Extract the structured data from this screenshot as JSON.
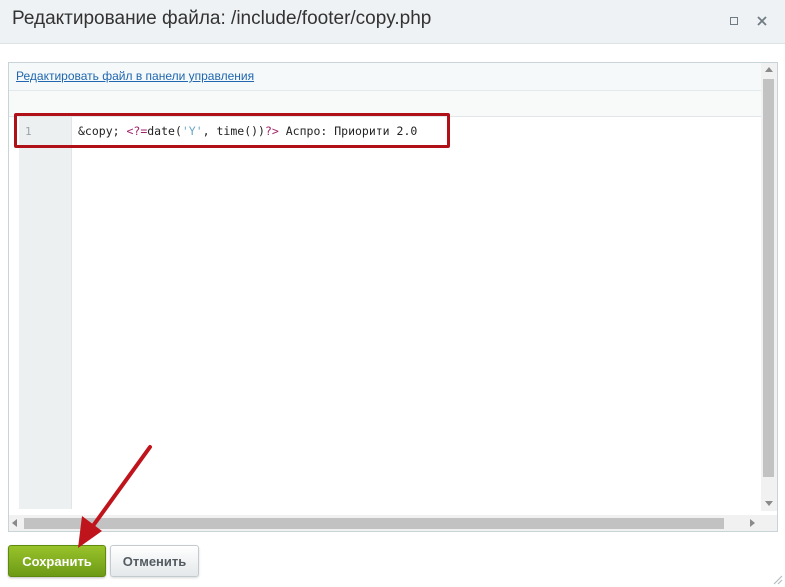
{
  "dialog": {
    "title": "Редактирование файла: /include/footer/copy.php"
  },
  "editor": {
    "edit_link": "Редактировать файл в панели управления",
    "line_number": "1",
    "code": {
      "entity": "&copy; ",
      "php_open": "<?=",
      "func": "date(",
      "string": "'Y'",
      "rest": ", time())",
      "php_close": "?>",
      "text": " Аспро: Приорити 2.0"
    }
  },
  "buttons": {
    "save_label": "Сохранить",
    "cancel_label": "Отменить"
  },
  "colors": {
    "save_button": "#7aa81e",
    "highlight_box": "#b01018",
    "annotation_arrow": "#c0141c"
  }
}
